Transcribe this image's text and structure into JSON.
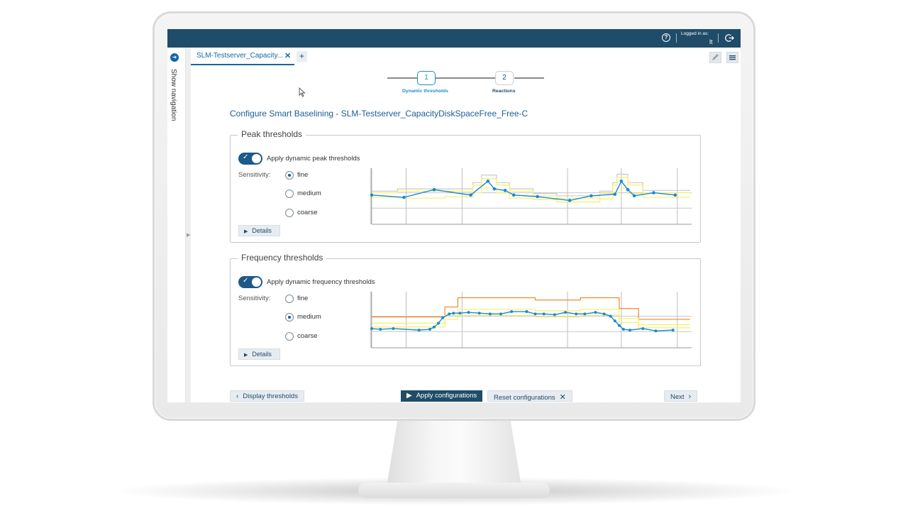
{
  "topbar": {
    "help_icon": "?",
    "logged_in_label": "Logged in as:",
    "user": "lt",
    "logout_icon": "logout-icon"
  },
  "nav": {
    "show_navigation": "Show navigation",
    "arrow_icon": "arrow-right-icon"
  },
  "tabs": [
    {
      "label": "SLM-Testserver_Capacity...",
      "close": "✕"
    }
  ],
  "tab_add": "+",
  "stepper": {
    "steps": [
      {
        "number": "1",
        "label": "Dynamic thresholds",
        "active": true
      },
      {
        "number": "2",
        "label": "Reactions",
        "active": false
      }
    ]
  },
  "page_title": "Configure Smart Baselining - SLM-Testserver_CapacityDiskSpaceFree_Free-C",
  "peak": {
    "legend": "Peak thresholds",
    "toggle_label": "Apply dynamic peak thresholds",
    "toggle_on": true,
    "sensitivity_label": "Sensitivity:",
    "options": [
      "fine",
      "medium",
      "coarse"
    ],
    "selected": "fine",
    "details_label": "Details"
  },
  "frequency": {
    "legend": "Frequency thresholds",
    "toggle_label": "Apply dynamic frequency thresholds",
    "toggle_on": true,
    "sensitivity_label": "Sensitivity:",
    "options": [
      "fine",
      "medium",
      "coarse"
    ],
    "selected": "medium",
    "details_label": "Details"
  },
  "buttons": {
    "display_thresholds": "Display thresholds",
    "apply": "Apply configurations",
    "reset": "Reset configurations",
    "next": "Next"
  },
  "colors": {
    "header": "#1f4c68",
    "accent": "#1565a8",
    "series": "#1b8ad6",
    "band_inner": "#f6ef6a",
    "band_outer": "#c9c9c9",
    "band_freq": "#f08a2c"
  },
  "chart_data": [
    {
      "type": "line",
      "name": "peak-chart",
      "title": "",
      "x": [
        0,
        1.5,
        3.2,
        4.7,
        6.3,
        6.7,
        7.0,
        7.3,
        8.2,
        8.5,
        9.1,
        10.2,
        11.8,
        13.3,
        13.6,
        14.2,
        15.1,
        15.5,
        16.2,
        17.3,
        18.3
      ],
      "y": [
        5.6,
        6.4,
        5.5,
        5.2,
        8.1,
        6.5,
        6.2,
        5.3,
        5.0,
        4.6,
        5.3,
        5.1,
        5.2,
        5.4,
        6.4,
        5.0,
        5.6,
        5.5,
        6.0,
        5.5,
        5.3
      ],
      "points": [
        [
          0,
          3.7
        ],
        [
          1.5,
          3.4
        ],
        [
          2.9,
          4.4
        ],
        [
          4.6,
          3.7
        ],
        [
          5.4,
          5.5
        ],
        [
          5.7,
          4.5
        ],
        [
          6.2,
          4.3
        ],
        [
          6.6,
          3.7
        ],
        [
          7.7,
          3.5
        ],
        [
          9.2,
          3.0
        ],
        [
          10.2,
          3.6
        ],
        [
          11.3,
          3.8
        ],
        [
          11.6,
          5.5
        ],
        [
          11.9,
          4.4
        ],
        [
          12.2,
          3.6
        ],
        [
          13.1,
          4.0
        ],
        [
          14.1,
          3.7
        ]
      ],
      "series": [
        {
          "values": [
            3.7,
            3.9,
            4.4,
            4.0,
            3.7,
            5.5,
            4.5,
            4.3,
            3.7,
            3.5,
            3.0,
            3.6,
            3.8,
            5.5,
            4.4,
            3.6,
            4.0,
            3.7
          ]
        }
      ],
      "xlim": [
        0,
        14.8
      ],
      "ylim": [
        0,
        7
      ],
      "grid": true
    },
    {
      "type": "line",
      "name": "frequency-chart",
      "title": "",
      "x": [
        0,
        0.4,
        1.0,
        2.2,
        2.7,
        2.9,
        3.1,
        3.3,
        3.6,
        3.8,
        4.1,
        4.5,
        5.0,
        5.5,
        6.0,
        6.5,
        7.2,
        7.6,
        8.0,
        8.5,
        9.0,
        9.5,
        9.9,
        10.4,
        10.8,
        11.1,
        11.3,
        11.5,
        11.7,
        12.0,
        12.6,
        13.2,
        14.0
      ],
      "y": [
        2.4,
        2.3,
        2.4,
        2.2,
        2.3,
        2.6,
        3.1,
        3.8,
        4.3,
        4.4,
        4.4,
        4.5,
        4.4,
        4.3,
        4.3,
        4.6,
        4.6,
        4.3,
        4.3,
        4.2,
        4.5,
        4.3,
        4.3,
        4.5,
        4.3,
        4.0,
        3.4,
        2.8,
        2.3,
        2.2,
        2.4,
        2.1,
        2.2
      ],
      "xlim": [
        0,
        14.8
      ],
      "ylim": [
        0,
        7
      ],
      "grid": true
    }
  ]
}
